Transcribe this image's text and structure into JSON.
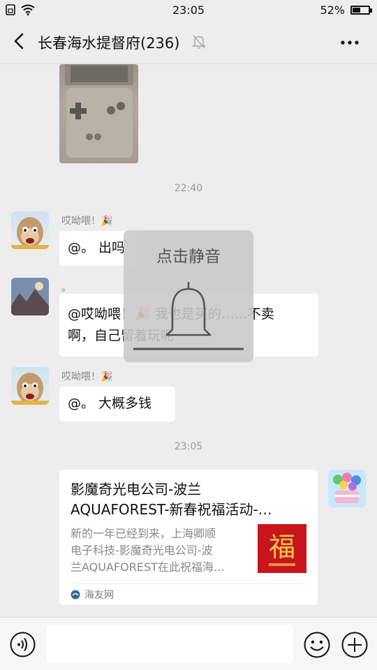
{
  "status_bar": {
    "time": "23:05",
    "battery": "52%",
    "battery_level": 0.52
  },
  "nav": {
    "title": "长春海水提督府(236)"
  },
  "messages": {
    "time1": "22:40",
    "msg1": {
      "sender": "哎呦喂！🎉",
      "text": "@。 出吗"
    },
    "msg2": {
      "sender": "。",
      "text_line1": "@哎呦喂！🎉 我也是买的……不卖",
      "text_line2": "啊，自己留着玩呢"
    },
    "msg3": {
      "sender": "哎呦喂！🎉",
      "text": "@。 大概多钱"
    },
    "time2": "23:05",
    "link": {
      "title_line1": "影魔奇光电公司-波兰",
      "title_line2": "AQUAFOREST-新春祝福活动-…",
      "desc_line1": "新的一年已经到来，上海卿顺",
      "desc_line2": "电子科技-影魔奇光电公司-波",
      "desc_line3": "兰AQUAFOREST在此祝福海…",
      "thumb_char": "福",
      "source": "海友网"
    }
  },
  "overlay": {
    "text": "点击静音"
  },
  "icons": {
    "back": "back-arrow-icon",
    "mute": "mute-bell-icon",
    "more": "more-dots-icon",
    "voice": "voice-icon",
    "emoji": "emoji-icon",
    "plus": "plus-icon"
  }
}
